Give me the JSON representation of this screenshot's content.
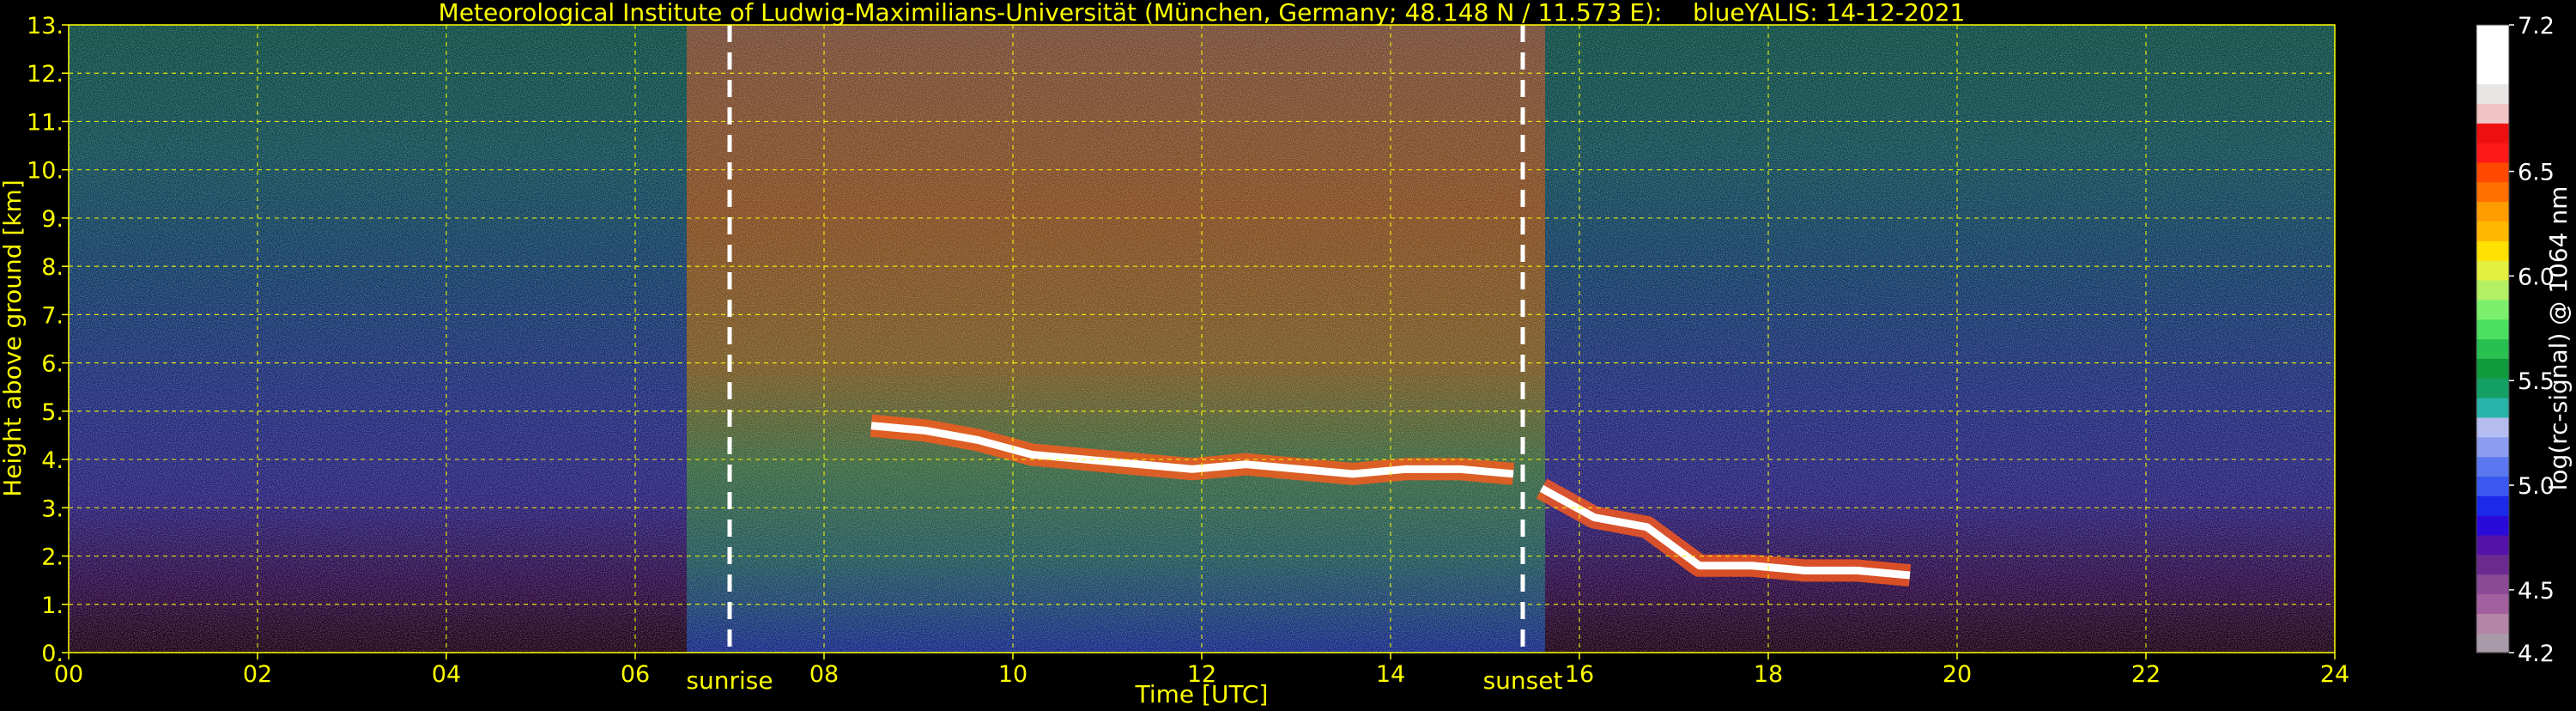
{
  "chart_data": {
    "type": "heatmap",
    "title": "Meteorological Institute of Ludwig-Maximilians-Universität (München, Germany; 48.148 N / 11.573 E):    blueYALIS: 14-12-2021",
    "xlabel": "Time [UTC]",
    "ylabel": "Height above ground [km]",
    "xlim": [
      0,
      24
    ],
    "ylim": [
      0,
      13
    ],
    "x_ticks": [
      0,
      2,
      4,
      6,
      8,
      10,
      12,
      14,
      16,
      18,
      20,
      22,
      24
    ],
    "x_tick_labels": [
      "00",
      "02",
      "04",
      "06",
      "08",
      "10",
      "12",
      "14",
      "16",
      "18",
      "20",
      "22",
      "24"
    ],
    "y_ticks": [
      0,
      1,
      2,
      3,
      4,
      5,
      6,
      7,
      8,
      9,
      10,
      11,
      12,
      13
    ],
    "y_tick_labels": [
      "0.",
      "1.",
      "2.",
      "3.",
      "4.",
      "5.",
      "6.",
      "7.",
      "8.",
      "9.",
      "10.",
      "11.",
      "12.",
      "13."
    ],
    "grid": true,
    "colorbar": {
      "label": "log(rc-signal) @ 1064 nm",
      "range": [
        4.2,
        7.2
      ],
      "tick_values": [
        4.2,
        4.5,
        5.0,
        5.5,
        6.0,
        6.5,
        7.2
      ],
      "tick_labels": [
        "4.2",
        "4.5",
        "5.0",
        "5.5",
        "6.0",
        "6.5",
        "7.2"
      ],
      "colors": [
        "#a89aa8",
        "#b484a8",
        "#a3609e",
        "#8a4a96",
        "#6c2a90",
        "#5512a8",
        "#2a0ad8",
        "#1a2ae8",
        "#3a58f0",
        "#5c78f0",
        "#8c9cf0",
        "#b4bcf0",
        "#28b4a8",
        "#14a064",
        "#109a3c",
        "#28c050",
        "#4ce060",
        "#7cf06c",
        "#b4f064",
        "#e4f040",
        "#ffe000",
        "#ffb800",
        "#ff9c00",
        "#ff7000",
        "#ff4800",
        "#ff1818",
        "#ee1010",
        "#f0c4c4",
        "#e8e4e4",
        "#ffffff",
        "#ffffff",
        "#ffffff"
      ]
    },
    "events": [
      {
        "label": "sunrise",
        "x": 7.0
      },
      {
        "label": "sunset",
        "x": 15.4
      }
    ],
    "cloud_layers": [
      {
        "x_start": 8.5,
        "x_end": 15.3,
        "y": [
          4.7,
          4.6,
          4.4,
          4.1,
          4.0,
          3.9,
          3.8,
          3.9,
          3.8,
          3.7,
          3.8,
          3.8,
          3.7
        ]
      },
      {
        "x_start": 15.6,
        "x_end": 19.5,
        "y": [
          3.4,
          2.8,
          2.6,
          1.8,
          1.8,
          1.7,
          1.7,
          1.6
        ]
      }
    ]
  }
}
